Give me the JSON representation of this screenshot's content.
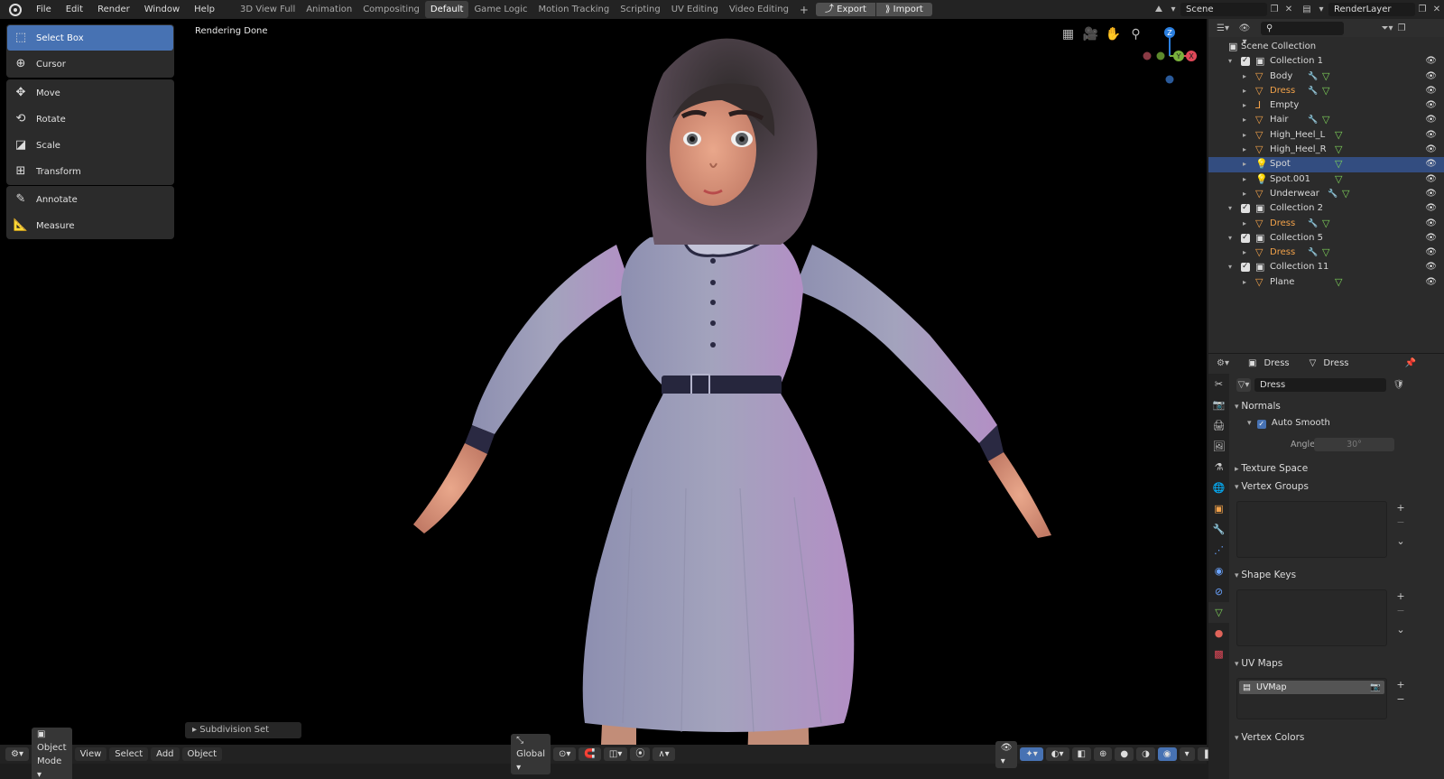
{
  "topbar": {
    "menu": [
      "File",
      "Edit",
      "Render",
      "Window",
      "Help"
    ],
    "workspaces": [
      "3D View Full",
      "Animation",
      "Compositing",
      "Default",
      "Game Logic",
      "Motion Tracking",
      "Scripting",
      "UV Editing",
      "Video Editing"
    ],
    "active_workspace": "Default",
    "add_workspace": "+",
    "export_label": "Export",
    "import_label": "Import",
    "scene": "Scene",
    "render_layer": "RenderLayer"
  },
  "viewport": {
    "status": "Rendering Done",
    "tools_group1": [
      "Select Box",
      "Cursor"
    ],
    "tools_group2": [
      "Move",
      "Rotate",
      "Scale",
      "Transform"
    ],
    "tools_group3": [
      "Annotate",
      "Measure"
    ],
    "active_tool": "Select Box",
    "last_operator": "Subdivision Set",
    "gizmo_axes": [
      "Z",
      "Y",
      "X"
    ]
  },
  "header": {
    "mode": "Object Mode",
    "view": "View",
    "select": "Select",
    "add": "Add",
    "object": "Object",
    "transform_orientation": "Global"
  },
  "outliner": {
    "root": "Scene Collection",
    "rows": [
      {
        "label": "Collection 1",
        "type": "collection"
      },
      {
        "label": "Body",
        "type": "mesh"
      },
      {
        "label": "Dress",
        "type": "mesh",
        "highlight": true
      },
      {
        "label": "Empty",
        "type": "empty"
      },
      {
        "label": "Hair",
        "type": "mesh"
      },
      {
        "label": "High_Heel_L",
        "type": "mesh"
      },
      {
        "label": "High_Heel_R",
        "type": "mesh"
      },
      {
        "label": "Spot",
        "type": "light",
        "selected": true
      },
      {
        "label": "Spot.001",
        "type": "light"
      },
      {
        "label": "Underwear",
        "type": "mesh"
      },
      {
        "label": "Collection 2",
        "type": "collection"
      },
      {
        "label": "Dress",
        "type": "mesh",
        "highlight": true
      },
      {
        "label": "Collection 5",
        "type": "collection"
      },
      {
        "label": "Dress",
        "type": "mesh",
        "highlight": true
      },
      {
        "label": "Collection 11",
        "type": "collection"
      },
      {
        "label": "Plane",
        "type": "mesh"
      }
    ]
  },
  "properties": {
    "object_name": "Dress",
    "data_name": "Dress",
    "mesh_field": "Dress",
    "normals": "Normals",
    "auto_smooth": "Auto Smooth",
    "angle_label": "Angle",
    "angle_value": "30°",
    "texture_space": "Texture Space",
    "vertex_groups": "Vertex Groups",
    "shape_keys": "Shape Keys",
    "uv_maps": "UV Maps",
    "uv_map_item": "UVMap",
    "vertex_colors": "Vertex Colors"
  }
}
